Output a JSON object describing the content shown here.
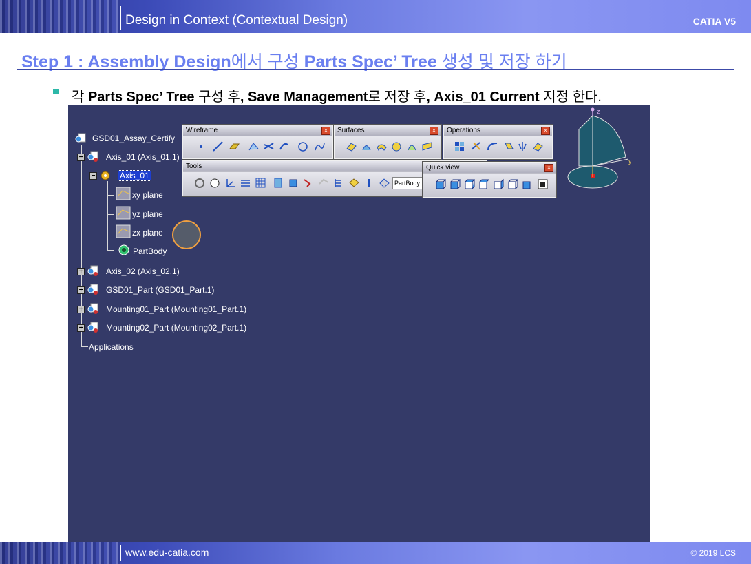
{
  "header": {
    "title": "Design in Context (Contextual Design)",
    "brand": "CATIA V5"
  },
  "footer": {
    "url": "www.edu-catia.com",
    "copyright": "© 2019 LCS"
  },
  "step": {
    "bold1": "Step 1 : Assembly Design",
    "plain1": "에서 구성 ",
    "bold2": "Parts Spec’ Tree",
    "plain2": " 생성 및 저장 하기"
  },
  "bullet": {
    "p1": "각 ",
    "b1": "Parts Spec’ Tree",
    "p2": " 구성 후",
    "b2": ", Save Management",
    "p3": "로 저장 후",
    "b3": ", Axis_01 Current",
    "p4": " 지정 한다."
  },
  "tree": {
    "root": "GSD01_Assay_Certify",
    "axis01": "Axis_01 (Axis_01.1)",
    "axis01_part": "Axis_01",
    "xy": "xy plane",
    "yz": "yz plane",
    "zx": "zx plane",
    "partbody": "PartBody",
    "axis02": "Axis_02 (Axis_02.1)",
    "gsd01": "GSD01_Part (GSD01_Part.1)",
    "mount01": "Mounting01_Part (Mounting01_Part.1)",
    "mount02": "Mounting02_Part (Mounting02_Part.1)",
    "applications": "Applications"
  },
  "toolbars": {
    "wireframe": "Wireframe",
    "surfaces": "Surfaces",
    "operations": "Operations",
    "tools": "Tools",
    "quickview": "Quick view",
    "partbody_combo": "PartBody"
  },
  "compass": {
    "z": "z",
    "y": "y"
  },
  "colors": {
    "viewport": "#343a68",
    "step_title": "#6a7ff0",
    "bullet": "#2db8a8"
  }
}
